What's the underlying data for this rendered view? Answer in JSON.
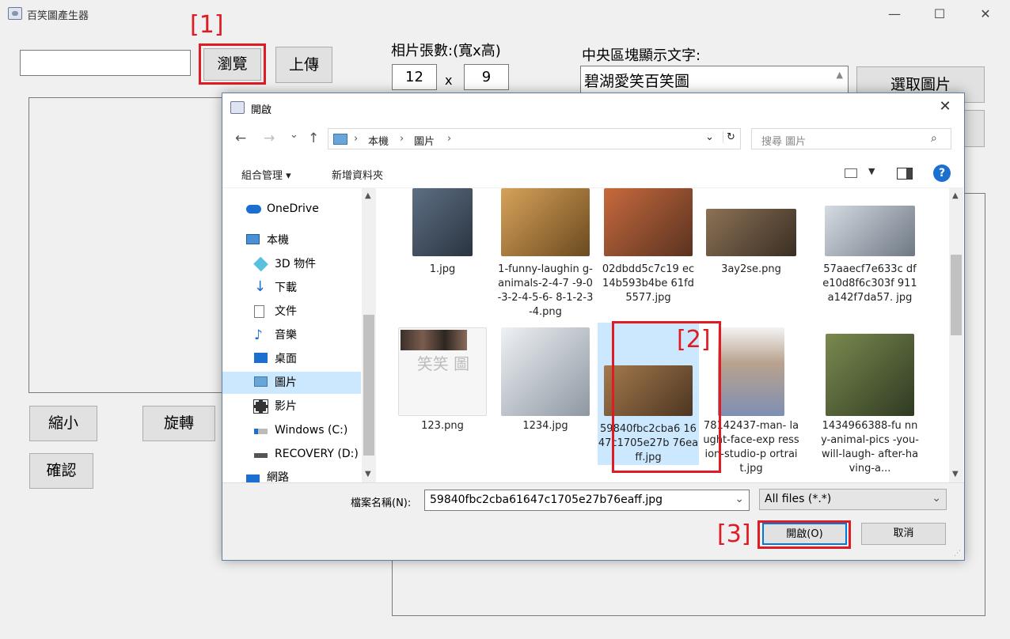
{
  "window": {
    "title": "百笑圖產生器",
    "minimize": "—",
    "maximize": "☐",
    "close": "✕"
  },
  "main": {
    "path_value": "",
    "browse_label": "瀏覽",
    "upload_label": "上傳",
    "photo_count_label": "相片張數:(寬x高)",
    "width_value": "12",
    "times_label": "x",
    "height_value": "9",
    "center_text_label": "中央區塊顯示文字:",
    "center_text_value": "碧湖愛笑百笑圖",
    "select_image_label": "選取圖片",
    "shrink_label": "縮小",
    "rotate_label": "旋轉",
    "confirm_label": "確認"
  },
  "steps": [
    "[1]",
    "[2]",
    "[3]"
  ],
  "dialog": {
    "title": "開啟",
    "close": "✕",
    "nav": {
      "back": "←",
      "forward": "→",
      "recent": "⌄",
      "up": "↑"
    },
    "address": [
      "本機",
      "圖片"
    ],
    "address_sep": "›",
    "refresh": "↻",
    "search_placeholder": "搜尋 圖片",
    "organize_label": "組合管理 ▾",
    "new_folder_label": "新增資料夾",
    "help": "?",
    "nav_items": [
      {
        "label": "OneDrive",
        "icon": "cloud-icon"
      },
      {
        "label": "本機",
        "icon": "computer-icon"
      },
      {
        "label": "3D 物件",
        "icon": "cube-icon"
      },
      {
        "label": "下載",
        "icon": "download-icon"
      },
      {
        "label": "文件",
        "icon": "document-icon"
      },
      {
        "label": "音樂",
        "icon": "music-icon"
      },
      {
        "label": "桌面",
        "icon": "desktop-icon"
      },
      {
        "label": "圖片",
        "icon": "pictures-icon"
      },
      {
        "label": "影片",
        "icon": "video-icon"
      },
      {
        "label": "Windows (C:)",
        "icon": "drive-icon"
      },
      {
        "label": "RECOVERY (D:)",
        "icon": "drive-icon"
      },
      {
        "label": "網路",
        "icon": "network-icon"
      }
    ],
    "files": [
      {
        "name": "1.jpg",
        "color": "#3b4a5a"
      },
      {
        "name": "1-funny-laughin g-animals-2-4-7 -9-0-3-2-4-5-6- 8-1-2-3-4.png",
        "color": "#b07a32"
      },
      {
        "name": "02dbdd5c7c19 ec14b593b4be 61fd5577.jpg",
        "color": "#a1492a"
      },
      {
        "name": "3ay2se.png",
        "color": "#6e5a44"
      },
      {
        "name": "57aaecf7e633c dfe10d8f6c303f 911a142f7da57. jpg",
        "color": "#9aa3ad"
      },
      {
        "name": "123.png",
        "color": "#f4f4f4",
        "overlay": "笑笑\n圖"
      },
      {
        "name": "1234.jpg",
        "color": "#c8ccd2"
      },
      {
        "name": "59840fbc2cba6 1647c1705e27b 76eaff.jpg",
        "color": "#7a5b3c"
      },
      {
        "name": "78142437-man- laught-face-exp ression-studio-p ortrait.jpg",
        "color": "#c9a98e"
      },
      {
        "name": "1434966388-fu nny-animal-pics -you-will-laugh- after-having-a...",
        "color": "#4a5b3a"
      }
    ],
    "filename_label": "檔案名稱(N):",
    "filename_value": "59840fbc2cba61647c1705e27b76eaff.jpg",
    "filetype_value": "All files (*.*)",
    "open_label": "開啟(O)",
    "cancel_label": "取消"
  }
}
